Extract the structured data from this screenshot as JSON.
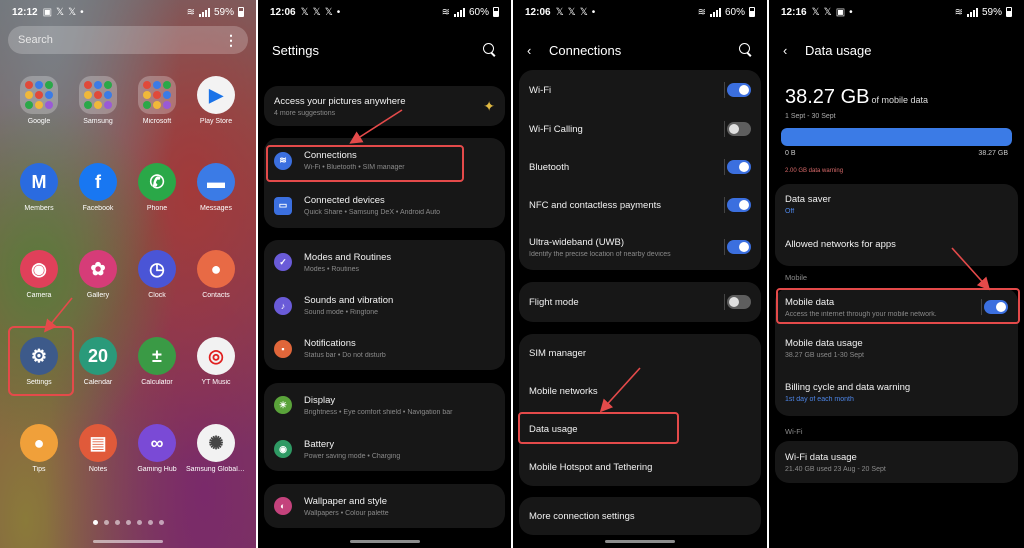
{
  "colors": {
    "accent": "#3b6fdf",
    "highlight": "#e44a4a",
    "background": "#000000",
    "card": "#171717"
  },
  "panel1": {
    "status": {
      "time": "12:12",
      "battery": "59%"
    },
    "search_placeholder": "Search",
    "apps": [
      {
        "label": "Google",
        "icon": "google-folder-icon"
      },
      {
        "label": "Samsung",
        "icon": "samsung-folder-icon"
      },
      {
        "label": "Microsoft",
        "icon": "microsoft-folder-icon"
      },
      {
        "label": "Play Store",
        "icon": "play-store-icon"
      },
      {
        "label": "Members",
        "icon": "members-icon"
      },
      {
        "label": "Facebook",
        "icon": "facebook-icon"
      },
      {
        "label": "Phone",
        "icon": "phone-icon"
      },
      {
        "label": "Messages",
        "icon": "messages-icon"
      },
      {
        "label": "Camera",
        "icon": "camera-icon"
      },
      {
        "label": "Gallery",
        "icon": "gallery-icon"
      },
      {
        "label": "Clock",
        "icon": "clock-icon"
      },
      {
        "label": "Contacts",
        "icon": "contacts-icon"
      },
      {
        "label": "Settings",
        "icon": "gear-icon"
      },
      {
        "label": "Calendar",
        "icon": "calendar-icon",
        "glyph": "20"
      },
      {
        "label": "Calculator",
        "icon": "calculator-icon"
      },
      {
        "label": "YT Music",
        "icon": "yt-music-icon"
      },
      {
        "label": "Tips",
        "icon": "tips-icon"
      },
      {
        "label": "Notes",
        "icon": "notes-icon"
      },
      {
        "label": "Gaming Hub",
        "icon": "gaming-hub-icon"
      },
      {
        "label": "Samsung Global Go...",
        "icon": "samsung-global-goals-icon"
      }
    ]
  },
  "panel2": {
    "status": {
      "time": "12:06",
      "battery": "60%"
    },
    "title": "Settings",
    "promo": {
      "title": "Access your pictures anywhere",
      "subtitle": "4 more suggestions"
    },
    "items": [
      {
        "title": "Connections",
        "subtitle": "Wi-Fi  •  Bluetooth  •  SIM manager"
      },
      {
        "title": "Connected devices",
        "subtitle": "Quick Share  •  Samsung DeX  •  Android Auto"
      },
      {
        "title": "Modes and Routines",
        "subtitle": "Modes  •  Routines"
      },
      {
        "title": "Sounds and vibration",
        "subtitle": "Sound mode  •  Ringtone"
      },
      {
        "title": "Notifications",
        "subtitle": "Status bar  •  Do not disturb"
      },
      {
        "title": "Display",
        "subtitle": "Brightness  •  Eye comfort shield  •  Navigation bar"
      },
      {
        "title": "Battery",
        "subtitle": "Power saving mode  •  Charging"
      },
      {
        "title": "Wallpaper and style",
        "subtitle": "Wallpapers  •  Colour palette"
      }
    ]
  },
  "panel3": {
    "status": {
      "time": "12:06",
      "battery": "60%"
    },
    "title": "Connections",
    "items": [
      {
        "title": "Wi-Fi",
        "toggle": true
      },
      {
        "title": "Wi-Fi Calling",
        "toggle": false
      },
      {
        "title": "Bluetooth",
        "toggle": true
      },
      {
        "title": "NFC and contactless payments",
        "toggle": true
      },
      {
        "title": "Ultra-wideband (UWB)",
        "subtitle": "Identify the precise location of nearby devices",
        "toggle": true
      },
      {
        "title": "Flight mode",
        "toggle": false
      },
      {
        "title": "SIM manager"
      },
      {
        "title": "Mobile networks"
      },
      {
        "title": "Data usage"
      },
      {
        "title": "Mobile Hotspot and Tethering"
      },
      {
        "title": "More connection settings"
      }
    ]
  },
  "panel4": {
    "status": {
      "time": "12:16",
      "battery": "59%"
    },
    "title": "Data usage",
    "amount": "38.27 GB",
    "amount_unit": "of mobile data",
    "period": "1 Sept - 30 Sept",
    "usage_fraction": 1.0,
    "bar_min": "0 B",
    "bar_max": "38.27 GB",
    "warning": "2.00 GB data warning",
    "data_saver": {
      "title": "Data saver",
      "subtitle": "Off"
    },
    "allowed": {
      "title": "Allowed networks for apps"
    },
    "section_mobile": "Mobile",
    "mobile_data": {
      "title": "Mobile data",
      "subtitle": "Access the internet through your mobile network.",
      "toggle": true
    },
    "mobile_usage": {
      "title": "Mobile data usage",
      "subtitle": "38.27 GB used 1-30 Sept"
    },
    "billing": {
      "title": "Billing cycle and data warning",
      "subtitle": "1st day of each month"
    },
    "section_wifi": "Wi-Fi",
    "wifi_usage": {
      "title": "Wi-Fi data usage",
      "subtitle": "21.40 GB used 23 Aug - 20 Sept"
    }
  }
}
